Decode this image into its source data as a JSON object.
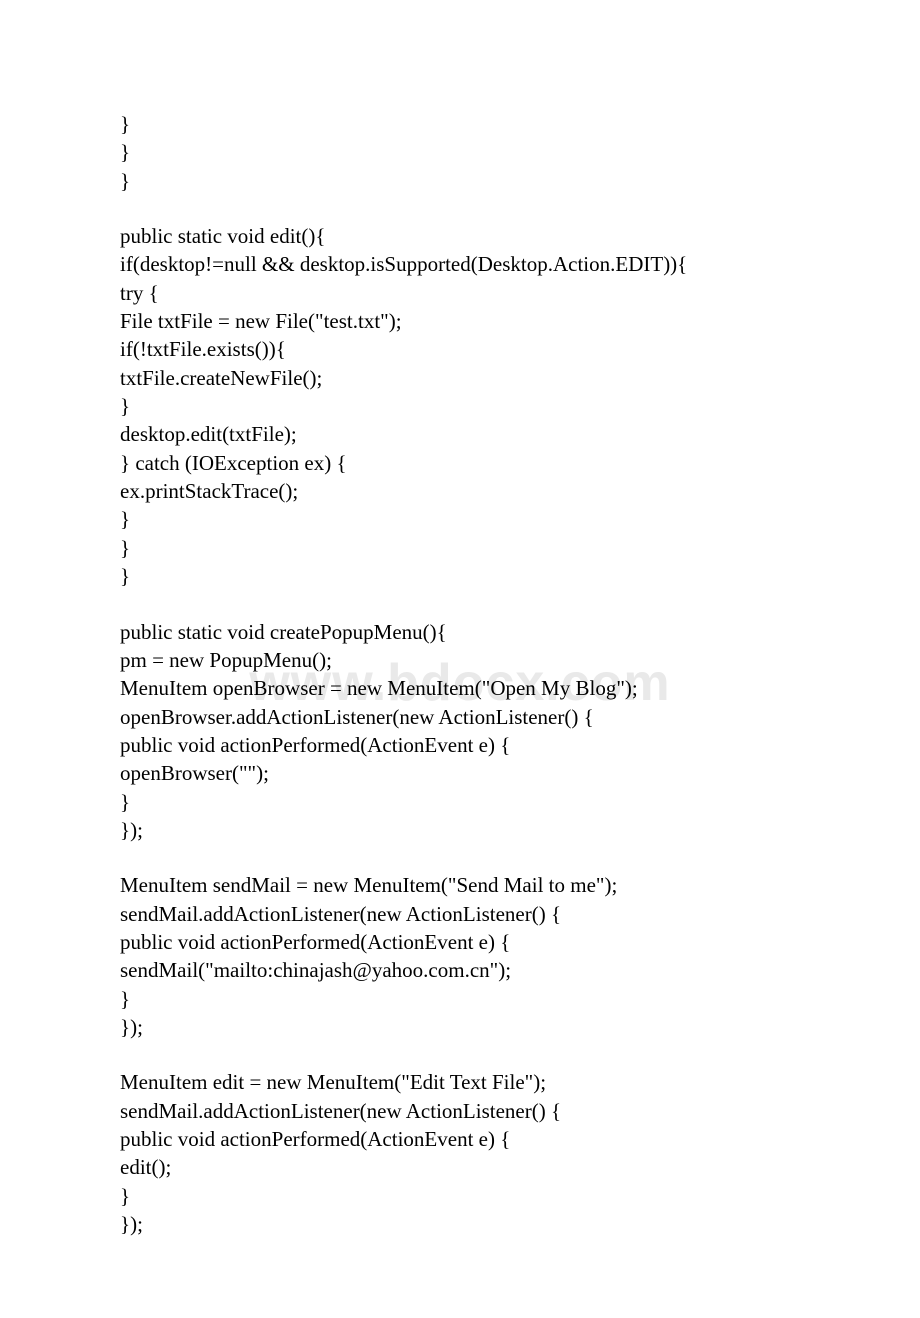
{
  "watermark": "www.bdocx.com",
  "code": {
    "block1": "}\n}\n}",
    "block2": "public static void edit(){\nif(desktop!=null && desktop.isSupported(Desktop.Action.EDIT)){\ntry {\nFile txtFile = new File(\"test.txt\");\nif(!txtFile.exists()){\ntxtFile.createNewFile();\n}\ndesktop.edit(txtFile);\n} catch (IOException ex) {\nex.printStackTrace();\n}\n}\n}",
    "block3": "public static void createPopupMenu(){\npm = new PopupMenu();\nMenuItem openBrowser = new MenuItem(\"Open My Blog\");\nopenBrowser.addActionListener(new ActionListener() {\npublic void actionPerformed(ActionEvent e) {\nopenBrowser(\"\");\n}\n});",
    "block4": "MenuItem sendMail = new MenuItem(\"Send Mail to me\");\nsendMail.addActionListener(new ActionListener() {\npublic void actionPerformed(ActionEvent e) {\nsendMail(\"mailto:chinajash@yahoo.com.cn\");\n}\n});",
    "block5": "MenuItem edit = new MenuItem(\"Edit Text File\");\nsendMail.addActionListener(new ActionListener() {\npublic void actionPerformed(ActionEvent e) {\nedit();\n}\n});"
  }
}
